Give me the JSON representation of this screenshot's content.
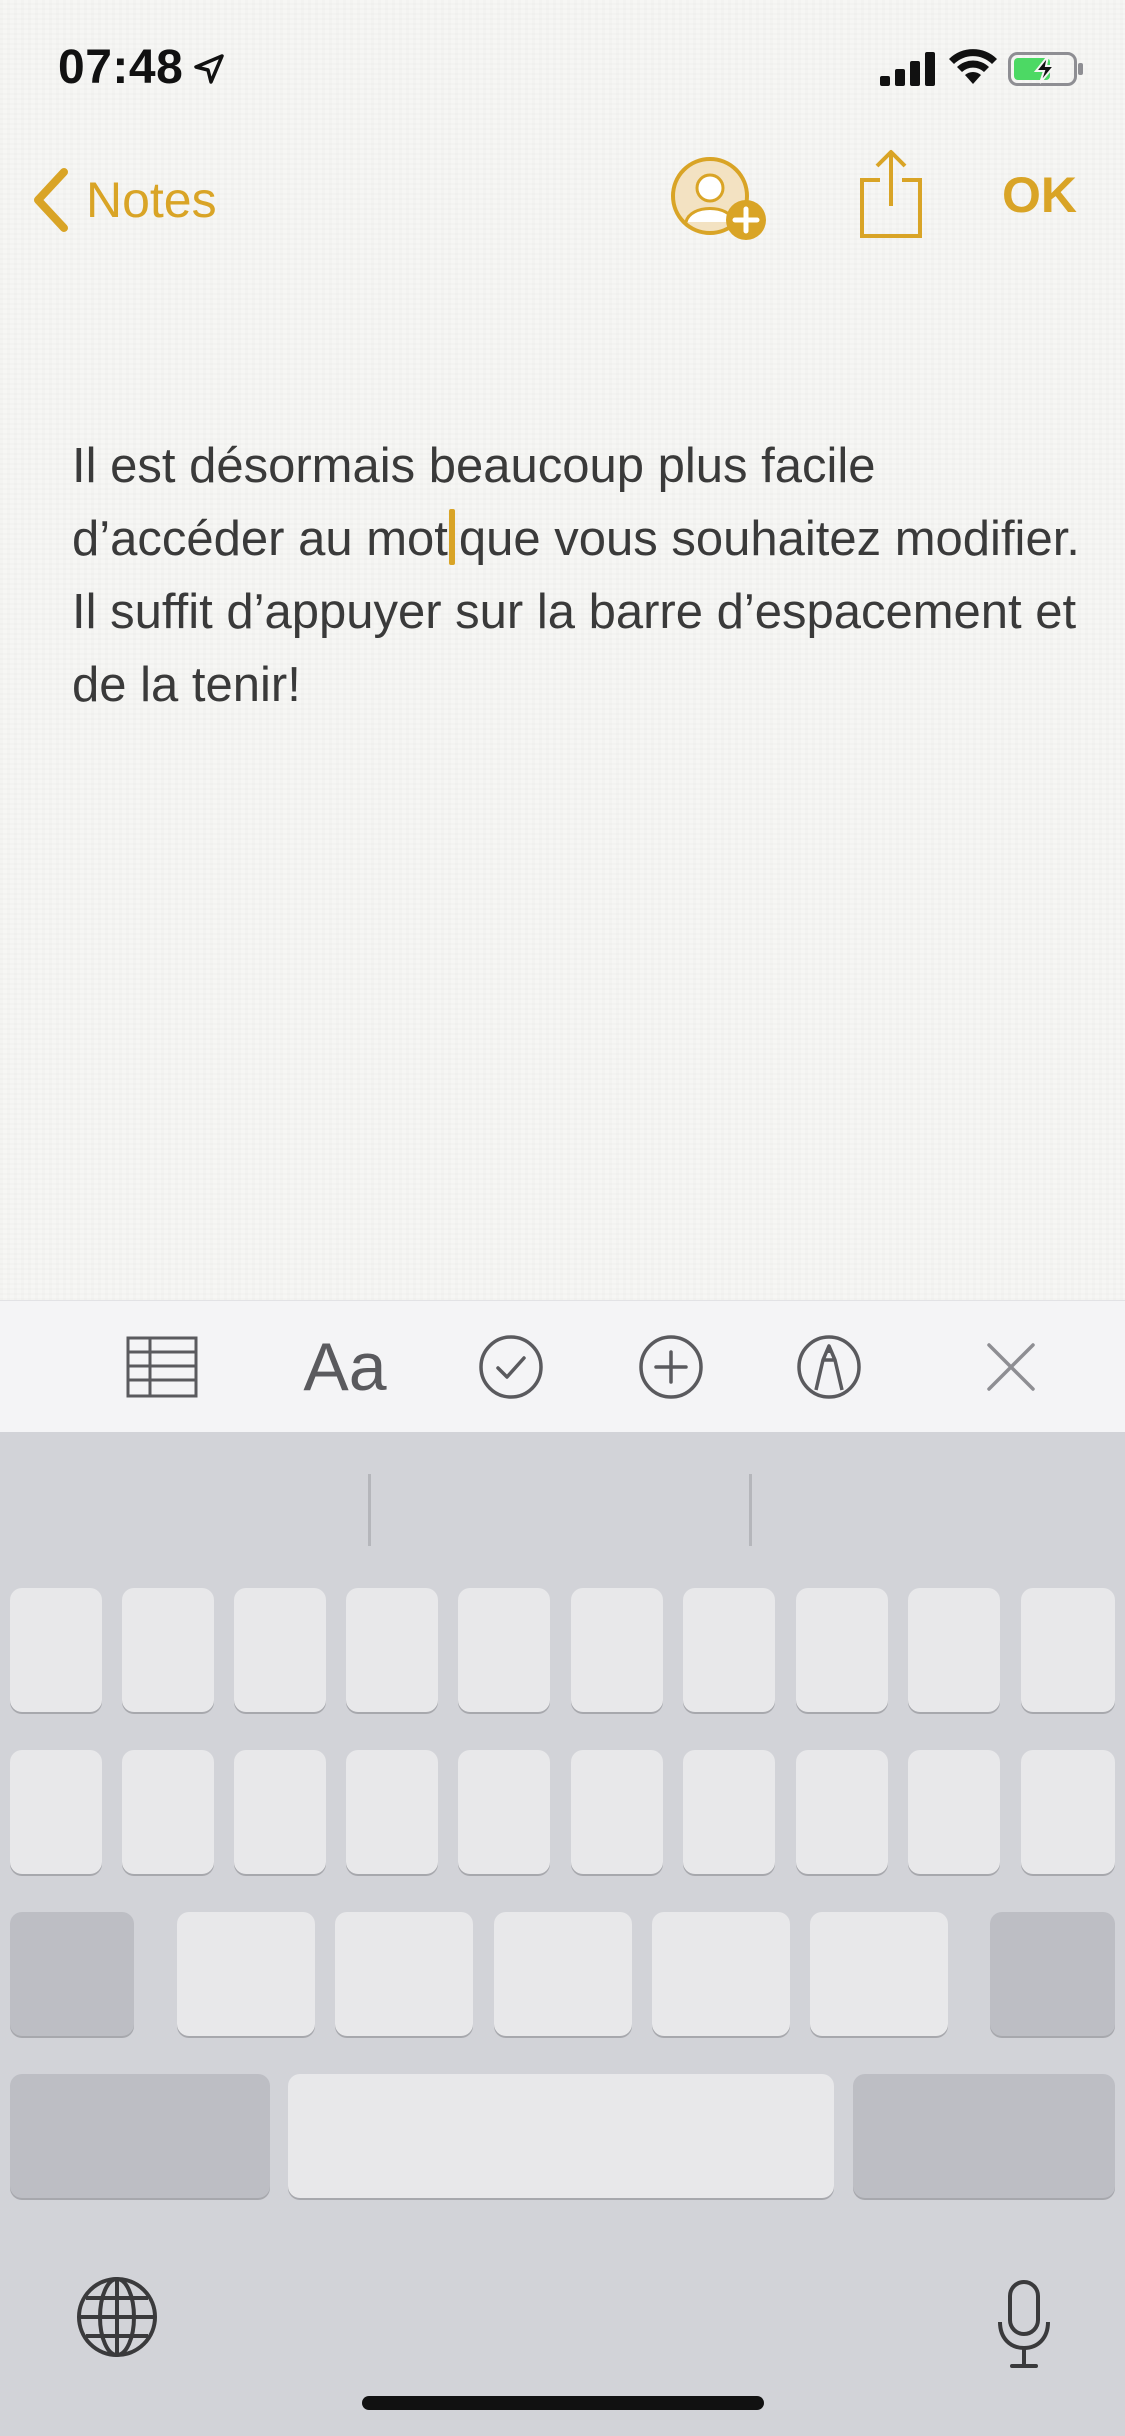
{
  "status_bar": {
    "time": "07:48",
    "icons": [
      "location-arrow-icon",
      "cellular-signal-icon",
      "wifi-icon",
      "battery-charging-icon"
    ]
  },
  "nav": {
    "back_label": "Notes",
    "ok_label": "OK",
    "icons": [
      "chevron-left-icon",
      "add-person-icon",
      "share-icon"
    ]
  },
  "note": {
    "text_before_cursor": "Il est désormais beaucoup plus facile d’accéder au mot",
    "text_after_cursor": "que vous souhaitez modifier. Il suffit d’appuyer sur la barre d’espacement et de la tenir!"
  },
  "toolbar": {
    "format_label": "Aa",
    "icons": [
      "table-icon",
      "checklist-icon",
      "add-icon",
      "markup-pen-icon",
      "close-icon"
    ]
  },
  "keyboard": {
    "mode": "trackpad",
    "icons": [
      "globe-icon",
      "microphone-icon"
    ]
  },
  "colors": {
    "accent": "#d9a426",
    "text": "#3a3a3a",
    "toolbar_bg": "#f4f4f6",
    "keyboard_bg": "#d2d3d8"
  }
}
